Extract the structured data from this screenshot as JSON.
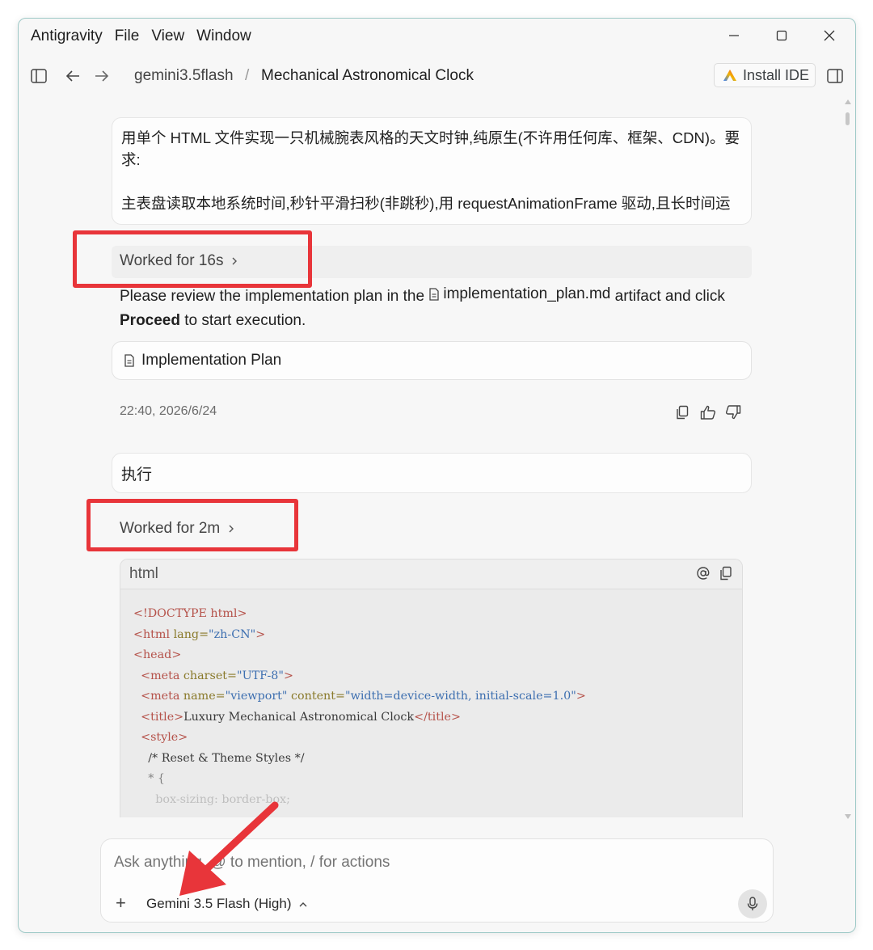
{
  "menu": [
    "Antigravity",
    "File",
    "View",
    "Window"
  ],
  "breadcrumb": {
    "project": "gemini3.5flash",
    "separator": "/",
    "conversation": "Mechanical Astronomical Clock"
  },
  "install_ide_label": "Install IDE",
  "prompt": {
    "line1": "用单个 HTML 文件实现一只机械腕表风格的天文时钟,纯原生(不许用任何库、框架、CDN)。要求:",
    "line2": "主表盘读取本地系统时间,秒针平滑扫秒(非跳秒),用 requestAnimationFrame 驱动,且长时间运"
  },
  "worked1": "Worked for 16s",
  "review": {
    "before": "Please review the implementation plan in the ",
    "file": "implementation_plan.md",
    "after": " artifact and click ",
    "proceed": "Proceed",
    "end": " to start execution."
  },
  "plan_card_label": "Implementation Plan",
  "timestamp": "22:40, 2026/6/24",
  "exec_message": "执行",
  "worked2": "Worked for 2m",
  "code": {
    "lang": "html",
    "l1": "<!DOCTYPE html>",
    "l2_tag": "<html ",
    "l2_attr": "lang=",
    "l2_val": "\"zh-CN\"",
    "l2_end": ">",
    "l3": "<head>",
    "l4_tag": "<meta ",
    "l4_attr": "charset=",
    "l4_val": "\"UTF-8\"",
    "l4_end": ">",
    "l5_tag": "<meta ",
    "l5_attr1": "name=",
    "l5_val1": "\"viewport\"",
    "l5_attr2": " content=",
    "l5_val2": "\"width=device-width, initial-scale=1.0\"",
    "l5_end": ">",
    "l6_open": "<title>",
    "l6_text": "Luxury Mechanical Astronomical Clock",
    "l6_close": "</title>",
    "l7": "<style>",
    "l8": "/* Reset & Theme Styles */",
    "l9": "* {",
    "l10": "box-sizing: border-box;"
  },
  "input": {
    "placeholder": "Ask anything, @ to mention, / for actions",
    "plus": "+",
    "model": "Gemini 3.5 Flash (High)"
  },
  "colors": {
    "highlight": "#e8353a",
    "window_border": "#9ec9c7",
    "background": "#f7f7f7"
  }
}
